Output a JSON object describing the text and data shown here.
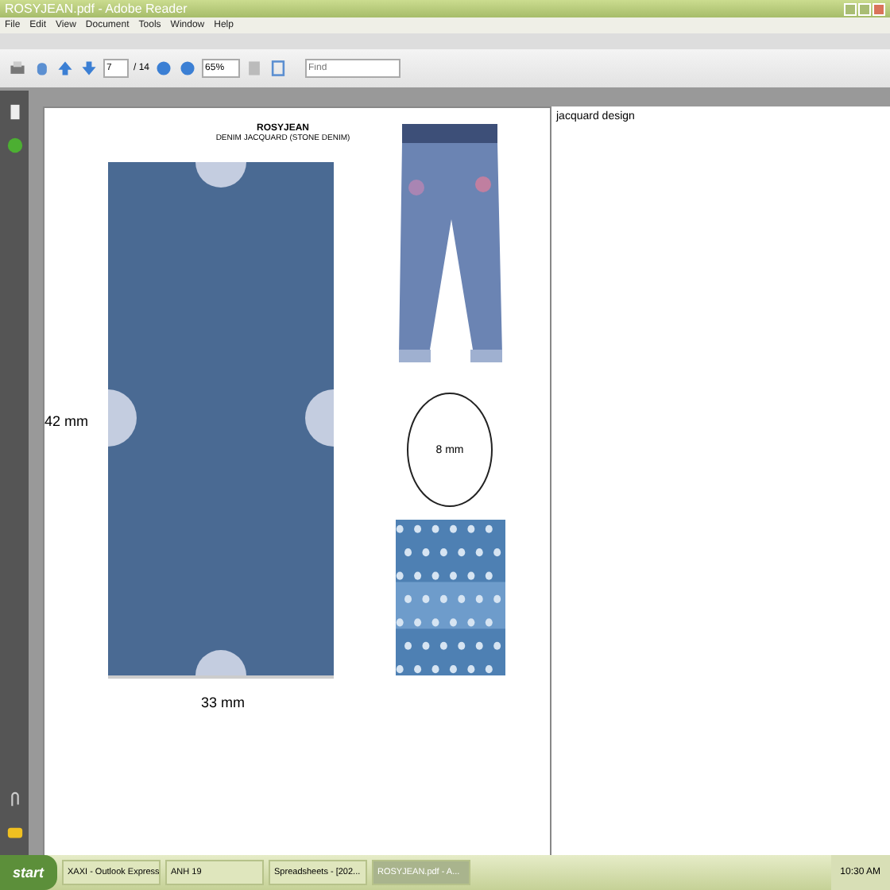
{
  "window": {
    "title": "ROSYJEAN.pdf - Adobe Reader"
  },
  "menu": [
    "File",
    "Edit",
    "View",
    "Document",
    "Tools",
    "Window",
    "Help"
  ],
  "toolbar": {
    "page": "7",
    "page_total": "/ 14",
    "zoom": "65%",
    "find_placeholder": "Find"
  },
  "document": {
    "title": "ROSYJEAN",
    "subtitle": "DENIM JACQUARD (STONE DENIM)",
    "height_label": "42 mm",
    "width_label": "33 mm",
    "dot_label": "8 mm",
    "note": "jacquard design"
  },
  "taskbar": {
    "start": "start",
    "tasks": [
      {
        "label": "XAXI - Outlook Express",
        "selected": false
      },
      {
        "label": "ANH 19",
        "selected": false
      },
      {
        "label": "Spreadsheets - [202...",
        "selected": false
      },
      {
        "label": "ROSYJEAN.pdf - A...",
        "selected": true
      }
    ],
    "clock": "10:30 AM"
  }
}
